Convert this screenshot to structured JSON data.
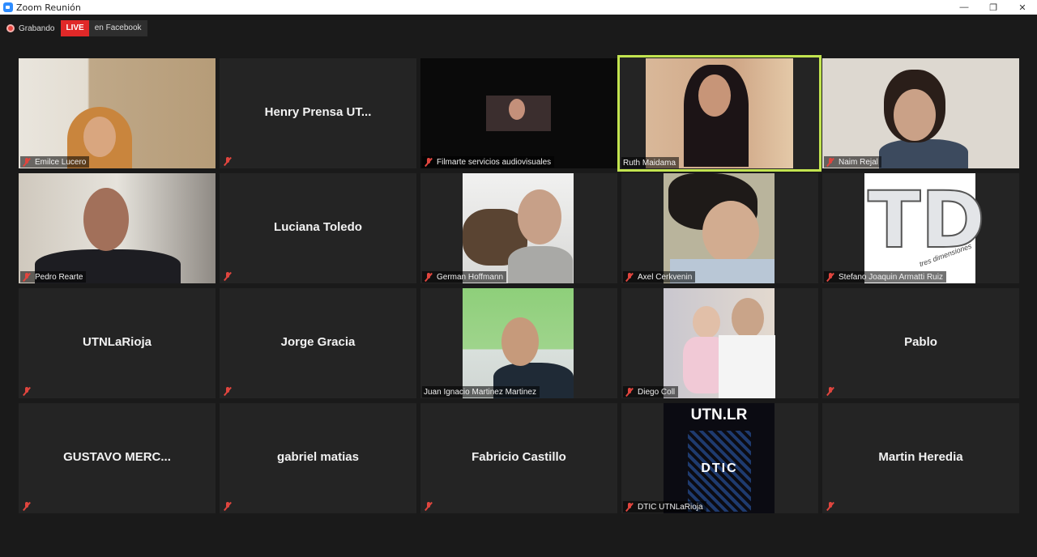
{
  "window": {
    "title": "Zoom Reunión",
    "controls": {
      "minimize": "—",
      "restore": "❐",
      "close": "✕"
    }
  },
  "recording": {
    "label": "Grabando",
    "live": "LIVE",
    "destination": "en Facebook"
  },
  "participants": [
    {
      "name": "Emilce Lucero",
      "muted": true,
      "video": true
    },
    {
      "name": "Henry Prensa UT...",
      "muted": true,
      "video": false
    },
    {
      "name": "Filmarte servicios audiovisuales",
      "muted": true,
      "video": true
    },
    {
      "name": "Ruth Maidama",
      "muted": false,
      "video": true,
      "speaking": true
    },
    {
      "name": "Naim Rejal",
      "muted": true,
      "video": true
    },
    {
      "name": "Pedro Rearte",
      "muted": true,
      "video": true
    },
    {
      "name": "Luciana Toledo",
      "muted": true,
      "video": false
    },
    {
      "name": "German Hoffmann",
      "muted": true,
      "video": true
    },
    {
      "name": "Axel Cerkvenin",
      "muted": true,
      "video": true
    },
    {
      "name": "Stefano Joaquin Armatti Ruiz",
      "muted": true,
      "video": true,
      "image_text": "TD",
      "image_caption": "tres dimensiones"
    },
    {
      "name": "UTNLaRioja",
      "muted": true,
      "video": false
    },
    {
      "name": "Jorge Gracia",
      "muted": true,
      "video": false
    },
    {
      "name": "Juan Ignacio Martinez Martinez",
      "muted": false,
      "video": true
    },
    {
      "name": "Diego Coll",
      "muted": true,
      "video": true
    },
    {
      "name": "Pablo",
      "muted": true,
      "video": false
    },
    {
      "name": "GUSTAVO  MERC...",
      "muted": true,
      "video": false
    },
    {
      "name": "gabriel matias",
      "muted": true,
      "video": false
    },
    {
      "name": "Fabricio Castillo",
      "muted": true,
      "video": false
    },
    {
      "name": "DTIC UTNLaRioja",
      "muted": true,
      "video": true,
      "logo_top": "UTN.LR",
      "logo_bottom": "DTIC"
    },
    {
      "name": "Martin Heredia",
      "muted": true,
      "video": false
    }
  ],
  "colors": {
    "active_speaker": "#c2e44f",
    "live": "#e02828",
    "muted_icon": "#e0453e"
  }
}
